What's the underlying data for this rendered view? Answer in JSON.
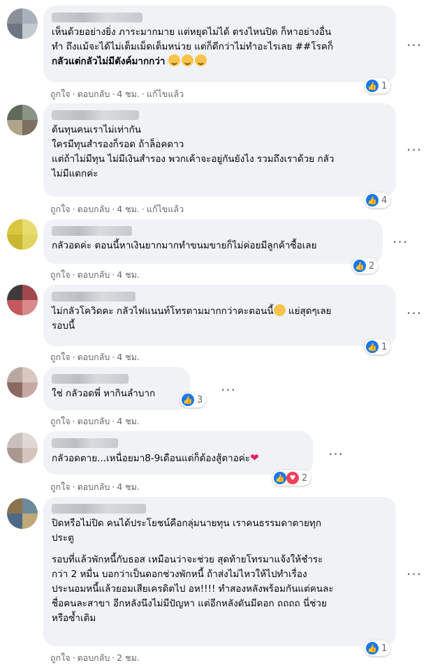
{
  "ui": {
    "like": "ถูกใจ",
    "reply": "ตอบกลับ",
    "edited": "แก้ไขแล้ว",
    "dot": "·",
    "more": "···"
  },
  "comments": [
    {
      "lines": [
        "เห็นด้วยอย่างยิ่ง ภาระมากมาย แต่หยุดไม่ได้ ตรงไหนปิด ก็หาอย่างอื่น",
        "ทำ ถึงแม้จะได้ไม่เต็มเม็ดเต็มหน่วย แต่ก็ดีกว่าไม่ทำอะไรเลย ##โรคก็",
        "กลัวแต่กลัวไม่มีตังค์มากกว่า"
      ],
      "time": "4 ชม.",
      "reaction_count": "1"
    },
    {
      "name_partial": "Noly Nangractal",
      "lines": [
        "ต้นทุนคนเราไม่เท่ากัน",
        "ใครมีทุนสำรองก็รอด ถ้าล็อคดาว",
        "แต่ถ้าไม่มีทุน ไม่มีเงินสำรอง พวกเค้าจะอยู่กันยังไง รวมถึงเราด้วย กลัว",
        "ไม่มีแดกค่ะ"
      ],
      "time": "4 ชม.",
      "reaction_count": "4"
    },
    {
      "lines": [
        "กลัวอดค่ะ ตอนนี้หาเงินยากมากทำขนมขายก็ไม่ค่อยมีลูกค้าซื้อเลย"
      ],
      "time": "4 ชม.",
      "reaction_count": "2"
    },
    {
      "lines": [
        "ไม่กลัวโควิดคะ กลัวไฟแนนท์โทรตามมากกว่าคะตอนนี้",
        "แย่สุดๆเลย",
        "รอบนี้"
      ],
      "time": "4 ชม.",
      "reaction_count": "1"
    },
    {
      "lines": [
        "ใช่ กลัวอดพี่ หากินลำบาก"
      ],
      "time": "4 ชม.",
      "reaction_count": "3"
    },
    {
      "lines": [
        "กลัวอดตาย...เหนื่อยมา8-9เดือนแต่ก็ต้องสู้ตาอค่ะ"
      ],
      "time": "4 ชม.",
      "reaction_count": "2"
    },
    {
      "lines": [
        "ปิดหรือไม่ปิด คนได้ประโยชน์คือกลุ่มนายทุน เราคนธรรมดาตายทุก",
        "ประตู",
        "รอบที่แล้วพักหนี้กับธอส เหมือนว่าจะช่วย สุดท้ายโทรมาแจ้งให้ชำระ",
        "กว่า 2 หมื่น บอกว่าเป็นดอกช่วงพักหนี้ ถ้าส่งไม่ไหวให้ไปทำเรื่อง",
        "ประนอมหนี้แล้วยอมเสียเครดิตไป อห!!!! ทำสองหลังพร้อมกันแต่คนละ",
        "ชื่อคนละสาขา อีกหลังนึงไม่มีปัญหา แต่อีกหลังดันมีดอก ถถถถ นี่ช่วย",
        "หรือซ้ำเติม"
      ],
      "time": "2 ชม.",
      "reaction_count": "1"
    }
  ]
}
